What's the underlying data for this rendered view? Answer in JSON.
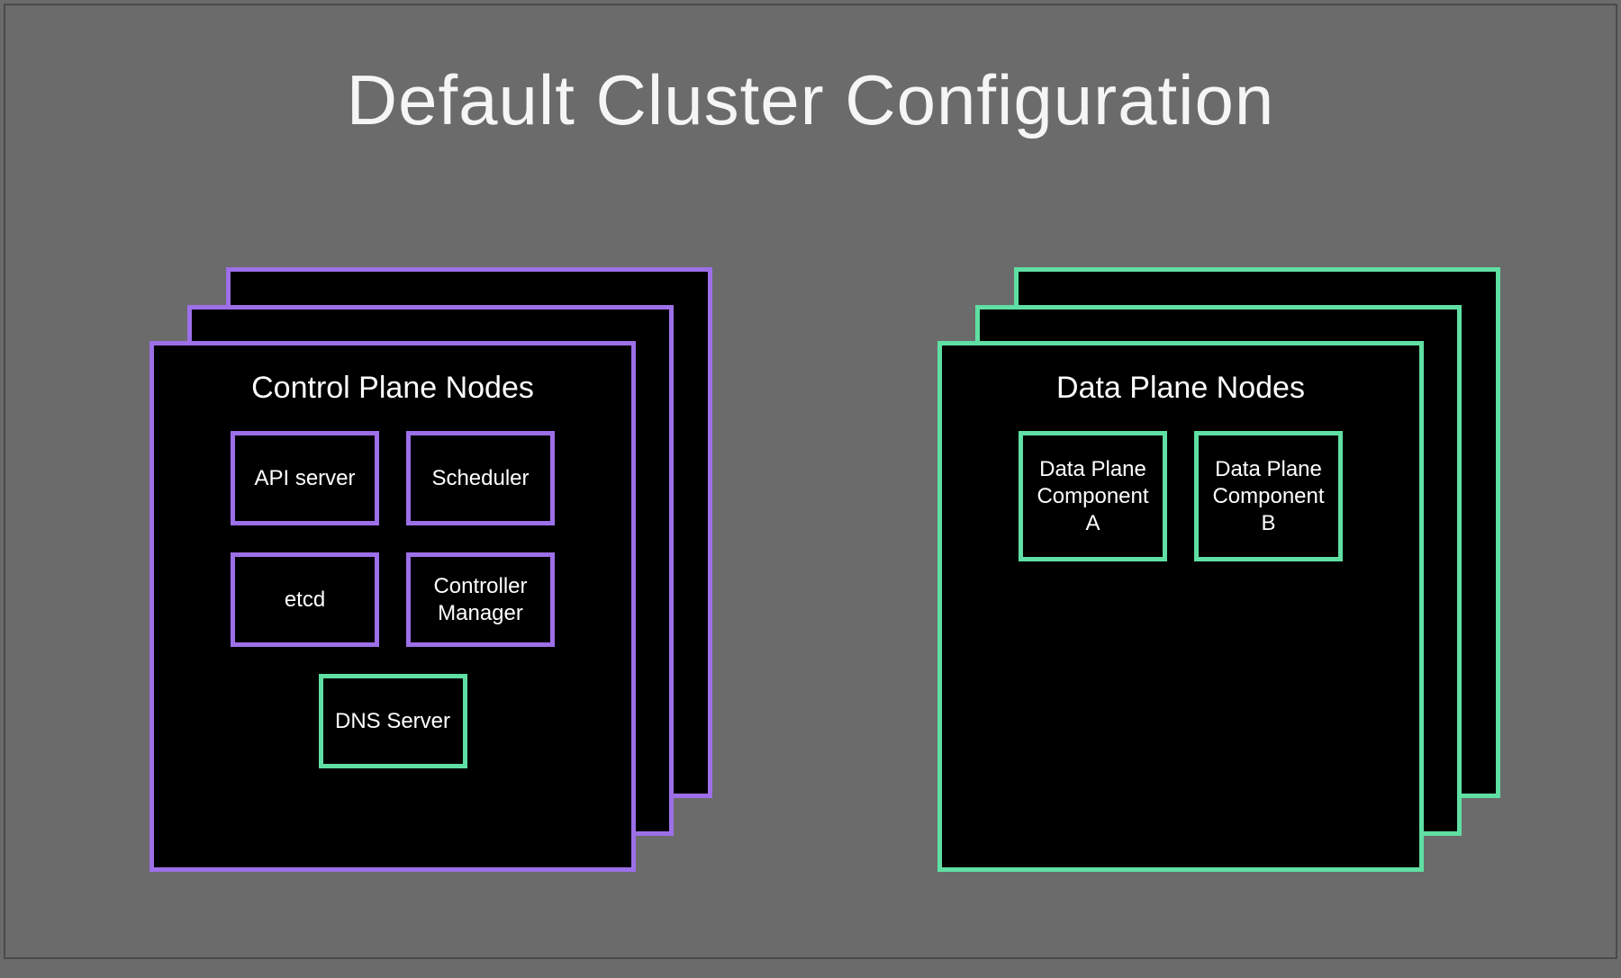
{
  "title": "Default Cluster Configuration",
  "control_plane": {
    "title": "Control Plane Nodes",
    "components": {
      "api_server": "API server",
      "scheduler": "Scheduler",
      "etcd": "etcd",
      "controller_manager": "Controller Manager",
      "dns_server": "DNS Server"
    }
  },
  "data_plane": {
    "title": "Data Plane Nodes",
    "components": {
      "component_a": "Data Plane Component A",
      "component_b": "Data Plane Component B"
    }
  },
  "colors": {
    "background": "#6b6b6b",
    "card_bg": "#000000",
    "purple": "#9d6fe8",
    "green": "#5fdfa3",
    "text": "#ffffff"
  }
}
